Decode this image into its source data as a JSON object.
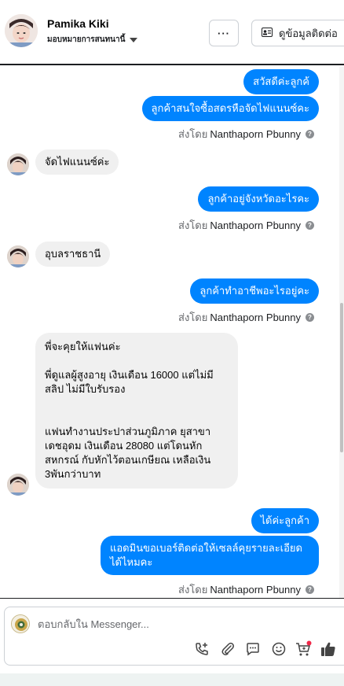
{
  "header": {
    "contact_name": "Pamika Kiki",
    "assign_label": "มอบหมายการสนทนานี้",
    "more_label": "···",
    "contact_button_label": "ดูข้อมูลติดต่อ"
  },
  "messages": {
    "m1": "สวัสดีค่ะลูกค้",
    "m2": "ลูกค้าสนใจซื้อสดรหือจัดไฟแนนซ์คะ",
    "m3": "จัดไฟแนนซ์ค่ะ",
    "m4": "ลูกค้าอยู่จังหวัดอะไรคะ",
    "m5": "อุบลราชธานี",
    "m6": "ลูกค้าทำอาชีพอะไรอยู่คะ",
    "m7": {
      "line1": "พี่จะคุยให้แฟนค่ะ",
      "line2": "พี่ดูแลผู้สูงอายุ เงินเดือน 16000  แต่ไม่มี",
      "line3": "สลิป ไม่มีใบรับรอง",
      "line4": "แฟนทำงานประปาส่วนภูมิภาค ยุสาขา",
      "line5": "เดชอุดม  เงินเดือน 28080  แต่โดนหัก",
      "line6": "สหกรณ์ กับหักไว้ตอนเกษียณ  เหลือเงิน",
      "line7": "3พันกว่าบาท"
    },
    "m8": "ได้ค่ะลูกค้า",
    "m9": {
      "line1": "แอดมินขอเบอร์ติดต่อให้เซลล์คุยรายละเอียด",
      "line2": "ได้ไหมคะ"
    }
  },
  "sent_by": {
    "prefix": "ส่งโดย",
    "name": "Nanthaporn Pbunny",
    "info": "?"
  },
  "composer": {
    "placeholder": "ตอบกลับใน Messenger..."
  },
  "colors": {
    "outgoing_bubble": "#0084ff",
    "incoming_bubble": "#f0f0f0",
    "secondary_text": "#65676b",
    "cart_dot": "#f02849"
  },
  "icons": {
    "tools": [
      "call-add-icon",
      "attachment-icon",
      "chat-bubble-icon",
      "emoji-icon",
      "cart-icon",
      "thumbs-up-icon"
    ]
  }
}
